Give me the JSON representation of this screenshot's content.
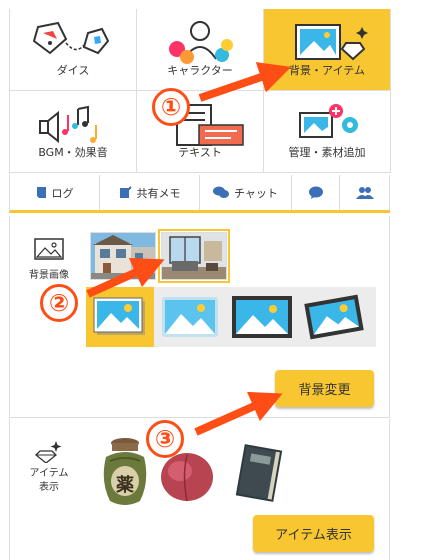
{
  "tools": [
    {
      "label": "ダイス",
      "icon": "dice-icon",
      "active": false
    },
    {
      "label": "キャラクター",
      "icon": "character-icon",
      "active": false
    },
    {
      "label": "背景・アイテム",
      "icon": "background-item-icon",
      "active": true
    },
    {
      "label": "BGM・効果音",
      "icon": "bgm-icon",
      "active": false
    },
    {
      "label": "テキスト",
      "icon": "text-icon",
      "active": false
    },
    {
      "label": "管理・素材追加",
      "icon": "manage-icon",
      "active": false
    }
  ],
  "tabs": [
    {
      "label": "ログ",
      "icon": "log-icon"
    },
    {
      "label": "共有メモ",
      "icon": "memo-icon"
    },
    {
      "label": "チャット",
      "icon": "chat-icon"
    },
    {
      "label": "",
      "icon": "speech-bubble-icon"
    },
    {
      "label": "",
      "icon": "users-icon"
    }
  ],
  "background": {
    "label": "背景画像",
    "button": "背景変更",
    "selected_thumbnail": 2,
    "selected_style": 1
  },
  "item": {
    "label": "アイテム表示",
    "button": "アイテム表示",
    "jar_text": "薬"
  },
  "annotations": [
    "①",
    "②",
    "③"
  ],
  "colors": {
    "accent": "#f7c631",
    "arrow": "#ff4d16",
    "border": "#dddddd"
  }
}
